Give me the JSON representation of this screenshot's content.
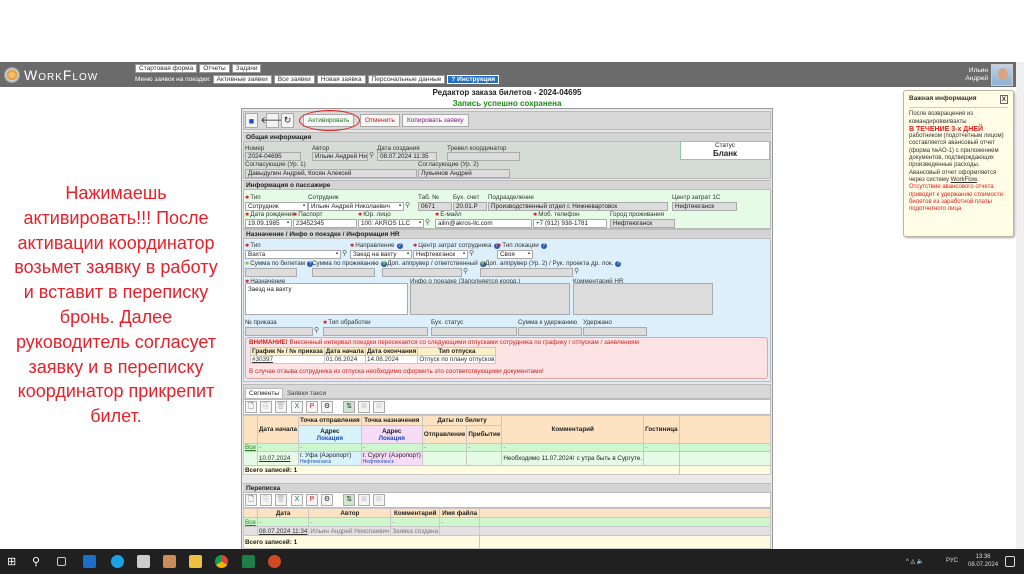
{
  "app": {
    "logo": "WorkFlow",
    "top_menu": [
      "Стартовая форма",
      "Отчеты",
      "Задачи"
    ],
    "submenu_label": "Меню заявок на поездки:",
    "submenu": [
      "Активные заявки",
      "Все заявки",
      "Новая заявка",
      "Персональные данные"
    ],
    "help": "Инструкция",
    "user": {
      "first": "Ильин",
      "second": "Андрей"
    }
  },
  "page": {
    "title": "Редактор заказа билетов - 2024-04695",
    "saved": "Запись успешно сохранена"
  },
  "toolbar": {
    "activate": "Активировать",
    "cancel": "Отменить",
    "copy": "Копировать заявку"
  },
  "general": {
    "header": "Общая информация",
    "status_label": "Статус",
    "status_value": "Бланк",
    "fields": [
      {
        "label": "Номер",
        "value": "2024-04695"
      },
      {
        "label": "Автор",
        "value": "Ильин Андрей Николаевич"
      },
      {
        "label": "Дата создания",
        "value": "08.07.2024 11:35"
      },
      {
        "label": "Тревел координатор",
        "value": ""
      },
      {
        "label": "Согласующие (Ур. 1)",
        "value": "Давыдулин Андрей, Косян Алексей"
      },
      {
        "label": "Согласующие (Ур. 2)",
        "value": "Лукьянов Андрей"
      }
    ]
  },
  "passenger": {
    "header": "Информация о пассажире",
    "fields": [
      {
        "label": "Тип",
        "value": "Сотрудник",
        "required": true
      },
      {
        "label": "Сотрудник",
        "value": "Ильин Андрей Николаевич"
      },
      {
        "label": "Таб. №",
        "value": "0671"
      },
      {
        "label": "Бух. счет",
        "value": "20.01.Р"
      },
      {
        "label": "Подразделение",
        "value": "Производственный отдел г. Нижневартовск"
      },
      {
        "label": "Центр затрат 1С",
        "value": "Нефтеюганск"
      },
      {
        "label": "Дата рождения",
        "value": "19.09.1985",
        "required": true
      },
      {
        "label": "Паспорт",
        "value": "23452345",
        "required": true
      },
      {
        "label": "Юр. лицо",
        "value": "100: AKROS LLC",
        "required": true
      },
      {
        "label": "E-майл",
        "value": "ailin@akros-llc.com",
        "required": true
      },
      {
        "label": "Моб. телефон",
        "value": "+7 (912) 938-1781",
        "required": true
      },
      {
        "label": "Город проживания",
        "value": "Нефтеюганск"
      }
    ]
  },
  "assignment": {
    "header": "Назначение / Инфо о поездке / Информация HR",
    "fields": [
      {
        "label": "Тип",
        "value": "Вахта",
        "required": true
      },
      {
        "label": "Направление",
        "value": "Заезд на вахту",
        "required": true,
        "help": true
      },
      {
        "label": "Центр затрат сотрудника",
        "value": "Нефтеюганск",
        "required": true,
        "help": true
      },
      {
        "label": "Тип локации",
        "value": "Своя",
        "required": true,
        "help": true
      },
      {
        "label": "Сумма по билетам",
        "value": "",
        "optional": true,
        "help": true
      },
      {
        "label": "Сумма по проживанию",
        "value": "",
        "help": true
      },
      {
        "label": "Доп. аппрувер / ответственный",
        "value": "",
        "optional": true,
        "help": true
      },
      {
        "label": "Доп. аппрувер (Ур. 2) / Рук. проекта др. лок.",
        "value": "",
        "optional": true,
        "help": true
      },
      {
        "label": "Назначение",
        "value": "Заезд на вахту",
        "required": true
      },
      {
        "label": "Инфо о поездке (Заполняется коорд.)",
        "value": ""
      },
      {
        "label": "Комментарий HR",
        "value": ""
      },
      {
        "label": "№ приказа",
        "value": ""
      },
      {
        "label": "Тип обработки",
        "value": "",
        "required": true
      },
      {
        "label": "Бух. статус",
        "value": ""
      },
      {
        "label": "Сумма к удержанию",
        "value": ""
      },
      {
        "label": "Удержано",
        "value": ""
      }
    ]
  },
  "warning": {
    "attention": "ВНИМАНИЕ!",
    "text": "Внесенный интервал поездки пересекается со следующими отпусками сотрудника по графику / отпускам / заявлениям",
    "columns": [
      "График № / № приказа",
      "Дата начала",
      "Дата окончания",
      "Тип отпуска"
    ],
    "rows": [
      [
        "#30397",
        "01.08.2024",
        "14.08.2024",
        "Отпуск по плану отпусков"
      ]
    ],
    "footer": "В случае отзыва сотрудника из отпуска необходимо оформить это соответствующими документами!"
  },
  "segments": {
    "tabs": [
      "Сегменты",
      "Заявки такси"
    ],
    "headers": {
      "start": "Дата начала",
      "from": "Точка отправления",
      "to": "Точка назначения",
      "ticket_dates": "Даты по билету",
      "address": "Адрес",
      "location": "Локация",
      "departure": "Отправление",
      "arrival": "Прибытие",
      "comment": "Комментарий",
      "hotel": "Гостиница"
    },
    "filter_all": "Все",
    "filter_dash": "-",
    "rows": [
      {
        "start": "10.07.2024",
        "from": "г. Уфа (Аэропорт)",
        "from_loc": "Нефтеюганск",
        "to": "г. Сургут (Аэропорт)",
        "to_loc": "Нефтеюганск",
        "departure": "",
        "arrival": "",
        "comment": "Необходимо 11.07.2024г с утра быть в Сургуте.",
        "hotel": ""
      }
    ],
    "total": "Всего записей: 1"
  },
  "correspondence": {
    "header": "Переписка",
    "columns": [
      "Дата",
      "Автор",
      "Комментарий",
      "Имя файла"
    ],
    "filter_all": "Все",
    "filter_dash": "-",
    "rows": [
      {
        "date": "08.07.2024 11:34",
        "author": "Ильин Андрей Николаевич",
        "comment": "Заявка создана",
        "file": ""
      }
    ],
    "total": "Всего записей: 1"
  },
  "annotation": {
    "lines": [
      "Нажимаешь",
      "активировать!!! После",
      "активации координатор",
      "возьмет заявку в работу",
      "и вставит в переписку",
      "бронь. Далее",
      "руководитель согласует",
      "заявку и в переписку",
      "координатор прикрепит",
      "билет."
    ]
  },
  "info_box": {
    "title": "Важная информация",
    "close": "X",
    "p1": "После возвращения из командировки/вахты",
    "p2": "В ТЕЧЕНИЕ 3-х ДНЕЙ",
    "p3": "работником (подотчетным лицом) составляется авансовый отчет (форма №АО-1) с приложением документов, подтверждающих произведенные расходы. Авансовый отчет оформляется через систему",
    "link": "WorkFlow",
    "p4": "Отсутствие авансового отчета приводит к удержанию стоимости билетов из заработной платы подотчетного лица"
  },
  "taskbar": {
    "lang": "РУС",
    "time": "13:36",
    "date": "08.07.2024"
  },
  "colors": {
    "accent": "#1e73c8",
    "annotation": "#e8202a",
    "success": "#1c8a1c"
  }
}
